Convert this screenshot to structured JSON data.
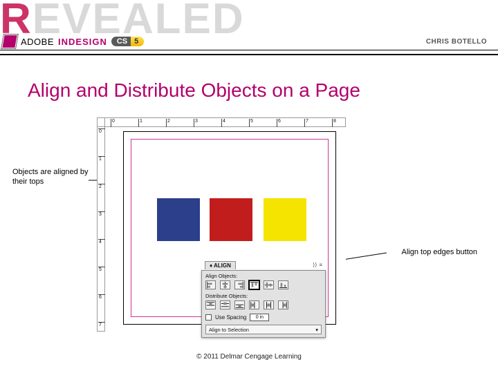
{
  "header": {
    "series_word": "REVEALED",
    "brand_adobe": "ADOBE",
    "brand_product": "INDESIGN",
    "badge_cs": "CS",
    "badge_ver": "5",
    "author": "CHRIS BOTELLO"
  },
  "slide": {
    "title": "Align and Distribute Objects on a Page",
    "callout_left": "Objects are aligned by their tops",
    "callout_right": "Align top edges button",
    "footer": "© 2011 Delmar Cengage Learning"
  },
  "ruler": {
    "h_labels": [
      "0",
      "1",
      "2",
      "3",
      "4",
      "5",
      "6",
      "7",
      "8"
    ],
    "v_labels": [
      "0",
      "1",
      "2",
      "3",
      "4",
      "5",
      "6",
      "7"
    ]
  },
  "panel": {
    "tab": "ALIGN",
    "close": "×",
    "menu": "≡",
    "chev": "⟩⟩",
    "align_label": "Align Objects:",
    "distribute_label": "Distribute Objects:",
    "use_spacing_label": "Use Spacing",
    "spacing_value": "0 in",
    "align_to_label": "Align to Selection",
    "dropdown_glyph": "▾",
    "icons": {
      "align": [
        "align-left",
        "align-h-center",
        "align-right",
        "align-top",
        "align-v-center",
        "align-bottom"
      ],
      "distribute": [
        "dist-top",
        "dist-v-center",
        "dist-bottom",
        "dist-left",
        "dist-h-center",
        "dist-right"
      ]
    }
  }
}
